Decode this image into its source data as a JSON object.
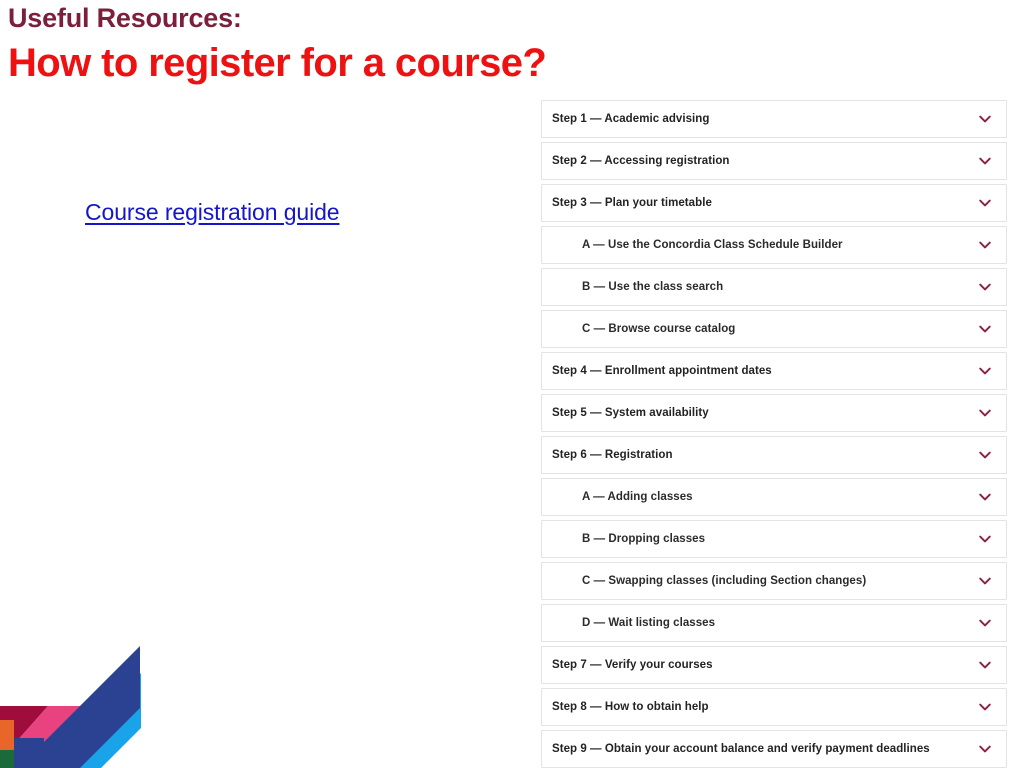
{
  "slide": {
    "eyebrow": "Useful Resources:",
    "title": "How to register for a course?",
    "link_text": "Course registration guide",
    "colors": {
      "eyebrow": "#7B1F3A",
      "title": "#ED1111",
      "link": "#1515CC",
      "chevron": "#8C2040",
      "card_border": "#E4E4E4",
      "brand_navy": "#2B4191",
      "brand_light_blue": "#19A3E8",
      "brand_pink": "#E8427F",
      "brand_dark_red": "#9E0D3C",
      "brand_orange": "#E8662A",
      "brand_green": "#1B6B3A"
    }
  },
  "accordion": {
    "icon": "chevron-down-icon",
    "items": [
      {
        "label": "Step 1 — Academic advising",
        "level": 0
      },
      {
        "label": "Step 2 — Accessing registration",
        "level": 0
      },
      {
        "label": "Step 3 — Plan your timetable",
        "level": 0
      },
      {
        "label": "A — Use the Concordia Class Schedule Builder",
        "level": 1
      },
      {
        "label": "B — Use the class search",
        "level": 1
      },
      {
        "label": "C — Browse course catalog",
        "level": 1
      },
      {
        "label": "Step 4 — Enrollment appointment dates",
        "level": 0
      },
      {
        "label": "Step 5 — System availability",
        "level": 0
      },
      {
        "label": "Step 6 — Registration",
        "level": 0
      },
      {
        "label": "A — Adding classes",
        "level": 1
      },
      {
        "label": "B — Dropping classes",
        "level": 1
      },
      {
        "label": "C — Swapping classes (including Section changes)",
        "level": 1
      },
      {
        "label": "D — Wait listing classes",
        "level": 1
      },
      {
        "label": "Step 7 — Verify your courses",
        "level": 0
      },
      {
        "label": "Step 8 — How to obtain help",
        "level": 0
      },
      {
        "label": "Step 9 — Obtain your account balance and verify payment deadlines",
        "level": 0
      }
    ]
  }
}
